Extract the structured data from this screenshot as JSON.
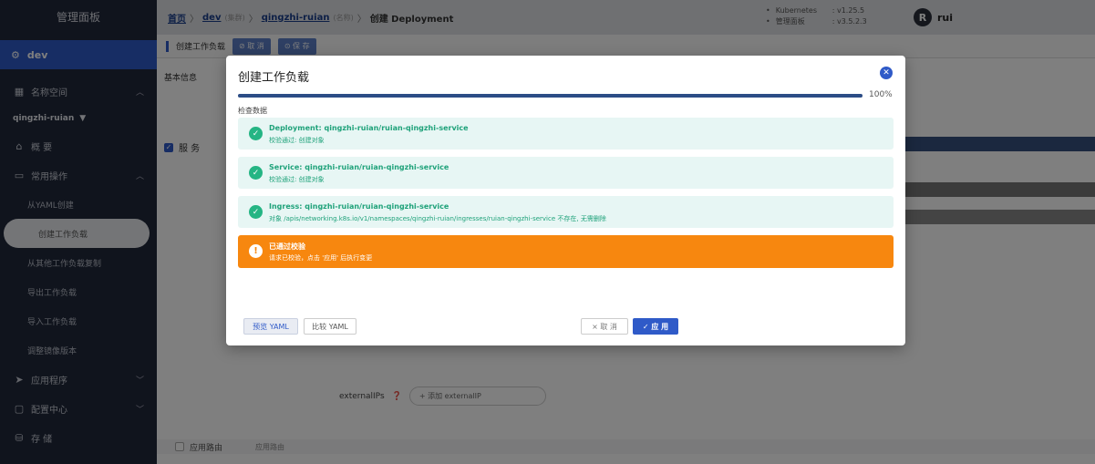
{
  "sidebar": {
    "title": "管理面板",
    "cluster": "dev",
    "items": [
      {
        "label": "名称空间",
        "icon": "grid-icon"
      },
      {
        "label": "概 要",
        "icon": "home-icon"
      },
      {
        "label": "常用操作",
        "icon": "folder-icon"
      }
    ],
    "namespace": "qingzhi-ruian",
    "sub_items": [
      "从YAML创建",
      "创建工作负载",
      "从其他工作负载复制",
      "导出工作负载",
      "导入工作负载",
      "调整镜像版本"
    ],
    "bottom_items": [
      {
        "label": "应用程序",
        "icon": "send-icon"
      },
      {
        "label": "配置中心",
        "icon": "box-icon"
      },
      {
        "label": "存 储",
        "icon": "database-icon"
      }
    ]
  },
  "topbar": {
    "breadcrumb": {
      "home": "首页",
      "cluster": "dev",
      "cluster_tag": "(集群)",
      "namespace": "qingzhi-ruian",
      "namespace_tag": "(名称)",
      "current": "创建 Deployment"
    },
    "versions": [
      {
        "key": "Kubernetes",
        "value": ": v1.25.5"
      },
      {
        "key": "管理面板",
        "value": ": v3.5.2.3"
      }
    ],
    "user": {
      "avatar": "R",
      "name": "rui"
    }
  },
  "page": {
    "toolbar_title": "创建工作负载",
    "cancel_label": "⊘ 取 消",
    "save_label": "⊙ 保 存",
    "tab_basic": "基本信息",
    "service_label": "服 务",
    "external_ips_label": "externalIPs",
    "add_external_ip": "+ 添加 externalIP",
    "route_label": "应用路由",
    "route_placeholder": "应用路由"
  },
  "modal": {
    "title": "创建工作负载",
    "progress_percent": 100,
    "progress_label": "100%",
    "section_label": "检查数据",
    "results": [
      {
        "title": "Deployment: qingzhi-ruian/ruian-qingzhi-service",
        "desc": "校验通过: 创建对象"
      },
      {
        "title": "Service: qingzhi-ruian/ruian-qingzhi-service",
        "desc": "校验通过: 创建对象"
      },
      {
        "title": "Ingress: qingzhi-ruian/ruian-qingzhi-service",
        "desc": "对象 /apis/networking.k8s.io/v1/namespaces/qingzhi-ruian/ingresses/ruian-qingzhi-service 不存在, 无需删除"
      }
    ],
    "warning": {
      "title": "已通过校验",
      "desc": "请求已校验，点击 '应用' 后执行变更"
    },
    "buttons": {
      "preview": "预览 YAML",
      "compare": "比较 YAML",
      "cancel": "× 取 消",
      "apply": "✓ 应 用"
    }
  },
  "colors": {
    "primary": "#2f5ac8",
    "success": "#25b584",
    "warning": "#f7870f",
    "sidebar": "#20283a"
  }
}
